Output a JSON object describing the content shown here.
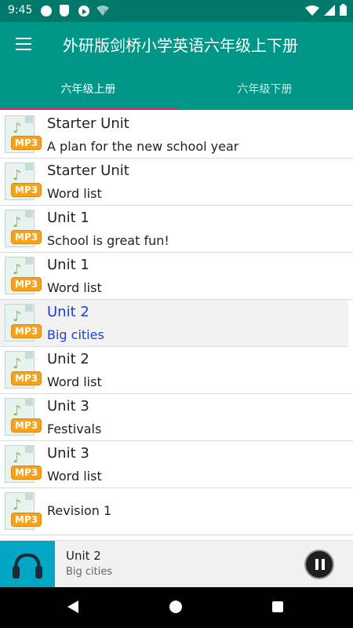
{
  "status_bar": {
    "time": "9:45",
    "icons": [
      "circle-notification-icon",
      "shield-icon",
      "play-notification-icon",
      "wifi-question-icon",
      "wifi-icon",
      "cell-signal-icon",
      "battery-icon"
    ]
  },
  "app_bar": {
    "title": "外研版剑桥小学英语六年级上下册",
    "menu_icon": "menu-icon"
  },
  "tabs": [
    {
      "label": "六年级上册",
      "active": true
    },
    {
      "label": "六年级下册",
      "active": false
    }
  ],
  "list": {
    "items": [
      {
        "title": "Starter Unit",
        "subtitle": "A plan for the new school year",
        "badge": "MP3"
      },
      {
        "title": "Starter Unit",
        "subtitle": "Word list",
        "badge": "MP3"
      },
      {
        "title": "Unit 1",
        "subtitle": "School is great fun!",
        "badge": "MP3"
      },
      {
        "title": "Unit 1",
        "subtitle": "Word list",
        "badge": "MP3"
      },
      {
        "title": "Unit 2",
        "subtitle": "Big cities",
        "badge": "MP3",
        "selected": true
      },
      {
        "title": "Unit 2",
        "subtitle": "Word list",
        "badge": "MP3"
      },
      {
        "title": "Unit 3",
        "subtitle": "Festivals",
        "badge": "MP3"
      },
      {
        "title": "Unit 3",
        "subtitle": "Word list",
        "badge": "MP3"
      },
      {
        "title": "Revision 1",
        "subtitle": "",
        "badge": "MP3"
      }
    ]
  },
  "player": {
    "title": "Unit 2",
    "subtitle": "Big cities",
    "art_icon": "headphones-icon",
    "control_icon": "pause-icon"
  },
  "colors": {
    "status_bar": "#00796b",
    "app_bar": "#009688",
    "tab_indicator": "#e91e63",
    "selected_text": "#1a3fd6",
    "player_art": "#00a6c4"
  }
}
